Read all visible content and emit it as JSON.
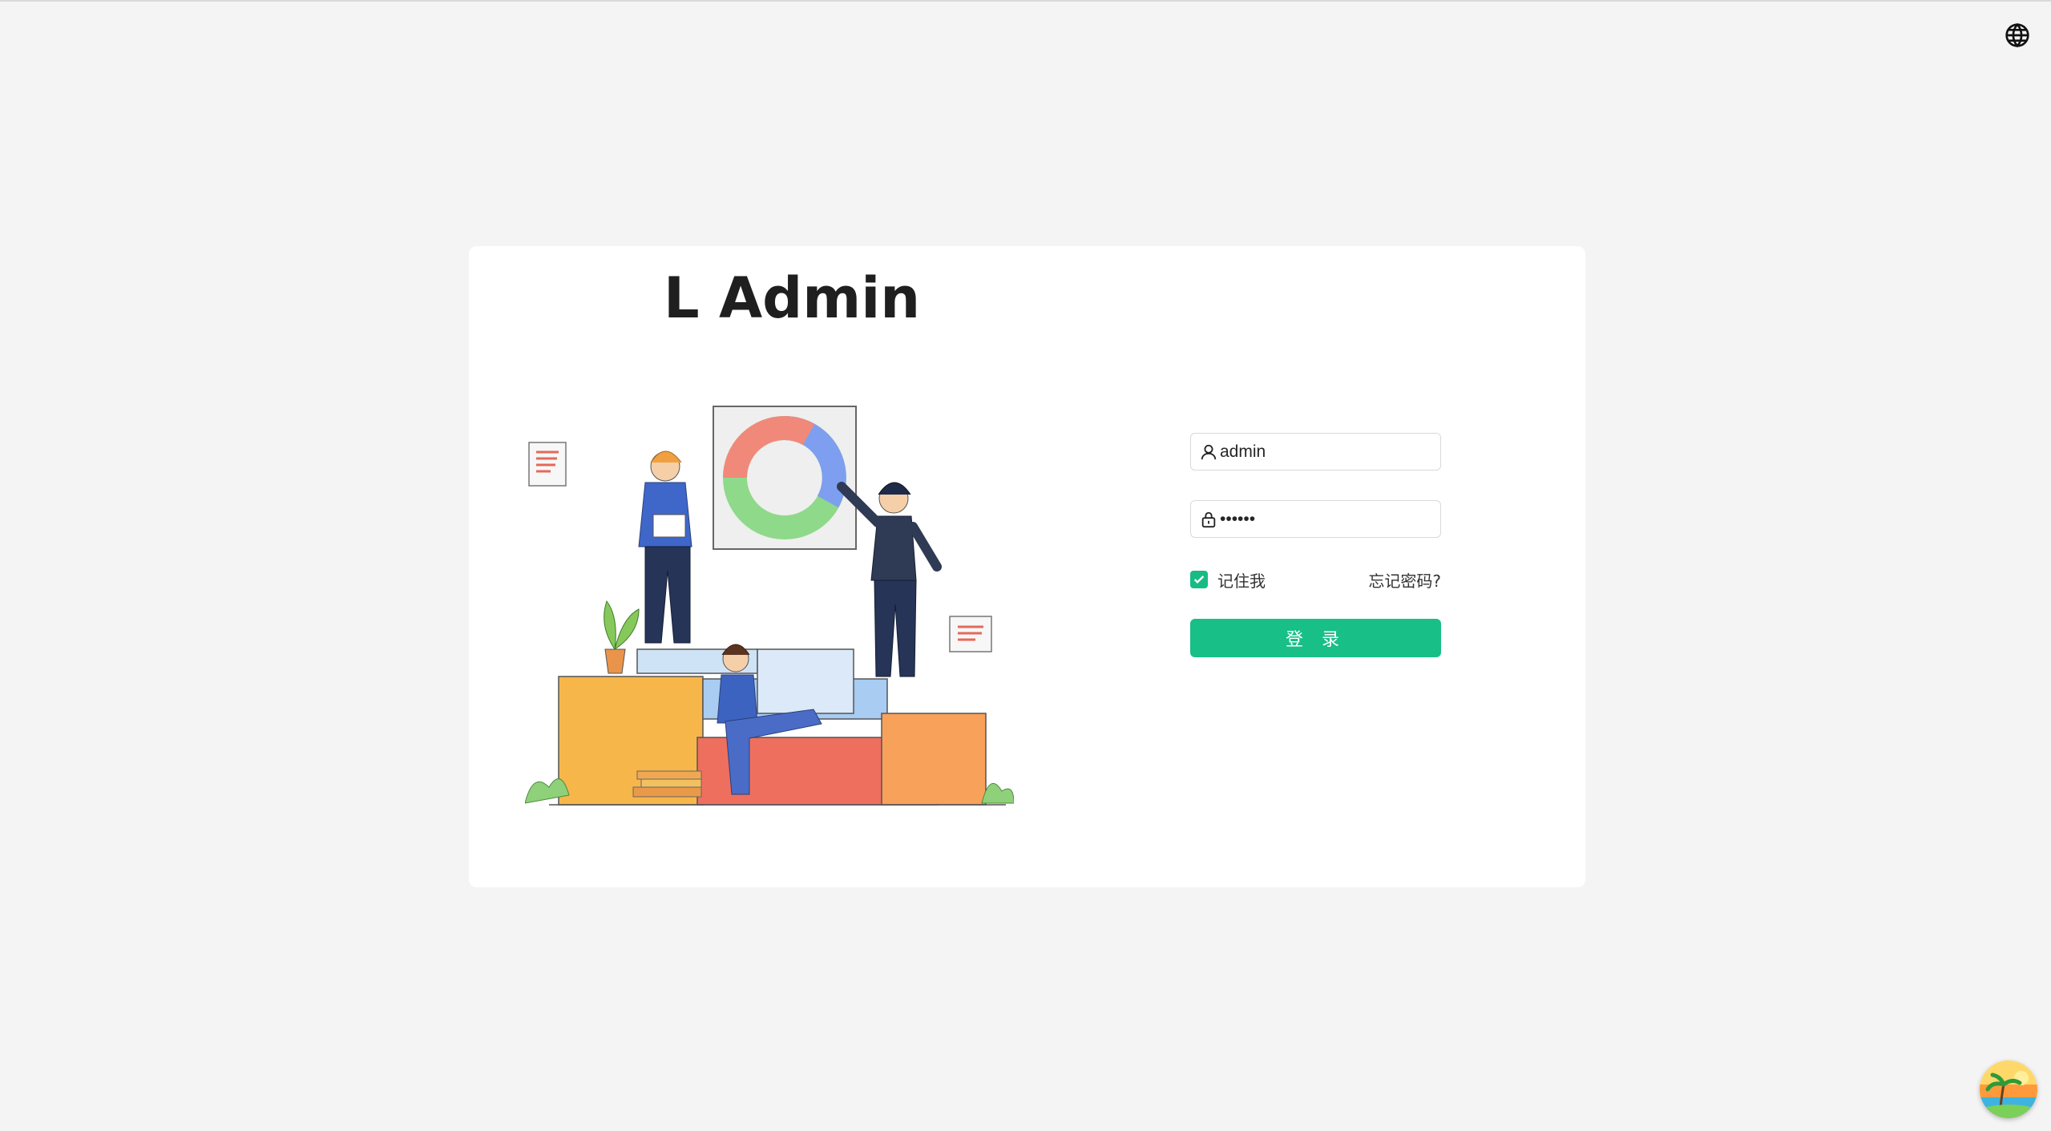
{
  "app": {
    "title": "L Admin"
  },
  "header": {
    "language_icon": "globe-icon"
  },
  "illustration": {
    "name": "team-data-illustration"
  },
  "login_form": {
    "username": {
      "value": "admin",
      "icon": "user-icon"
    },
    "password": {
      "value": "••••••",
      "icon": "lock-icon"
    },
    "remember": {
      "label": "记住我",
      "checked": true
    },
    "forgot_label": "忘记密码?",
    "submit_label": "登 录"
  },
  "assistant": {
    "icon": "beach-avatar-icon"
  },
  "colors": {
    "accent": "#18bf87",
    "background": "#f4f4f4",
    "card": "#ffffff"
  }
}
